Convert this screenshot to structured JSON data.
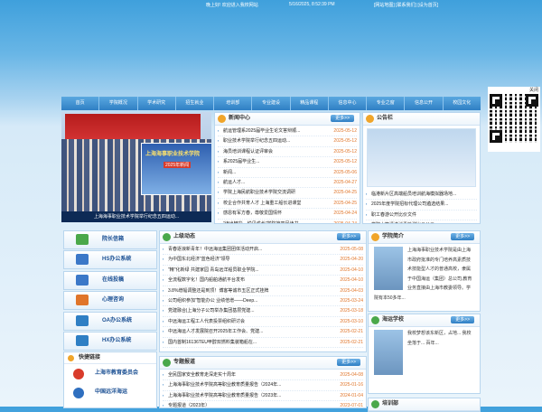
{
  "top": {
    "welcome": "晚上好! 欢迎进入我校网站",
    "datetime": "5/16/2025, 8:52:39 PM",
    "links": "[网站地图] [联系我们] [设为首页]"
  },
  "nav": [
    "首页",
    "学院概况",
    "学术研究",
    "招生就业",
    "培训部",
    "专业建设",
    "精品课程",
    "信息中心",
    "专业之窗",
    "信息公开",
    "校园文化"
  ],
  "qr": {
    "close_label": "关闭"
  },
  "photo": {
    "inset_title": "上海海事职业技术学院",
    "inset_badge": "2025年新闻",
    "caption": "上海海事职业技术学院举行纪念五四运动..."
  },
  "news": {
    "title": "新闻中心",
    "more": "更多>>",
    "items": [
      {
        "t": "航运管理系2025届毕业生论文答辩顺...",
        "d": "2025-05-12"
      },
      {
        "t": "职业技术学院举行纪念五四运动...",
        "d": "2025-05-12"
      },
      {
        "t": "海员培训课程认证评审会",
        "d": "2025-05-12"
      },
      {
        "t": "系2025届毕业生...",
        "d": "2025-05-12"
      },
      {
        "t": "新闻...",
        "d": "2025-05-06"
      },
      {
        "t": "航运人才...",
        "d": "2025-04-27"
      },
      {
        "t": "学院上海民航职业技术学院交流调研",
        "d": "2025-04-25"
      },
      {
        "t": "校企合作共育人才 上海重工船长进课堂",
        "d": "2025-04-25"
      },
      {
        "t": "感恩有军方春，尊敬爱国情怀",
        "d": "2025-04-24"
      },
      {
        "t": "\"读出精彩，悦见成长\"学院第四届读书...",
        "d": "2025-04-24"
      }
    ]
  },
  "notice": {
    "title": "公告栏",
    "items": [
      "临港新片区高端船员培训航海模拟器场地...",
      "2025年度学院招标代理公司遴选结果...",
      "职工春游公开比价文件",
      "学院水箱清洗消毒检测比价公示",
      "上海海运学校大礼堂黄浦水修理项目..."
    ]
  },
  "left_buttons": [
    {
      "label": "院长信箱",
      "color": "#4aa84a"
    },
    {
      "label": "HS办公系统",
      "color": "#3b78c8"
    },
    {
      "label": "在线投稿",
      "color": "#3b78c8"
    },
    {
      "label": "心理咨询",
      "color": "#e0752a"
    },
    {
      "label": "OA办公系统",
      "color": "#2f7fc4"
    },
    {
      "label": "HX办公系统",
      "color": "#2f7fc4"
    }
  ],
  "links": {
    "title": "快捷链接",
    "items": [
      {
        "label": "上海市教育委员会",
        "color": "#d93b2b"
      },
      {
        "label": "中国远洋海运",
        "color": "#2f6fbf"
      }
    ]
  },
  "updates": {
    "title": "上级动态",
    "more": "更多>>",
    "items": [
      {
        "t": "青春逐浪新青年！中远海运集团团体活动开启...",
        "d": "2025-05-08"
      },
      {
        "t": "为中国东北经济\"蓝色经济\"领导",
        "d": "2025-04-20"
      },
      {
        "t": "\"精\"化新绿 共建家园 青岛远洋船员职业学院...",
        "d": "2025-04-10"
      },
      {
        "t": "全流程数字化！国内船舶通航平台发布",
        "d": "2025-04-10"
      },
      {
        "t": "3.8%增幅调整还是到顶！博客等诚市五区正式挂牌",
        "d": "2025-04-03"
      },
      {
        "t": "公司组织参加\"智能办公 业绩倍增——Deep...",
        "d": "2025-03-24"
      },
      {
        "t": "党建融合|上海分子公司举办集团基层党建...",
        "d": "2025-03-18"
      },
      {
        "t": "中远海运工程工人代表投票组织研讨会",
        "d": "2025-03-10"
      },
      {
        "t": "中远海运人才发展院召开2025年工作会、党建...",
        "d": "2025-02-21"
      },
      {
        "t": "国内首制16136TEU甲醇双燃料集装箱船在...",
        "d": "2025-02-21"
      }
    ]
  },
  "special": {
    "title": "专题报道",
    "more": "更多>>",
    "items": [
      {
        "t": "全民国家安全教育走深走实十周年",
        "d": "2025-04-08"
      },
      {
        "t": "上海海事职业技术学院高等职业教育质量报告（2024年...",
        "d": "2025-01-16"
      },
      {
        "t": "上海海事职业技术学院高等职业教育质量报告（2023年...",
        "d": "2024-01-04"
      },
      {
        "t": "专题报道（2023年）",
        "d": "2023-07-01"
      }
    ]
  },
  "intro": {
    "title": "学院简介",
    "more": "更多>>",
    "text": "上海海事职业技术学院是由上海市政府批准的专门培养高素质技术技能型人才的普通高校，隶属于中国海运（集团）总公司,教育业务直接由上海市教委领导。学院有本50多年..."
  },
  "sea": {
    "title": "海运学校",
    "more": "更多>>",
    "text": "我校梦想该东新区，占地... 我校坐落于... 百年..."
  },
  "bottom_panel": {
    "title": "培训部"
  }
}
